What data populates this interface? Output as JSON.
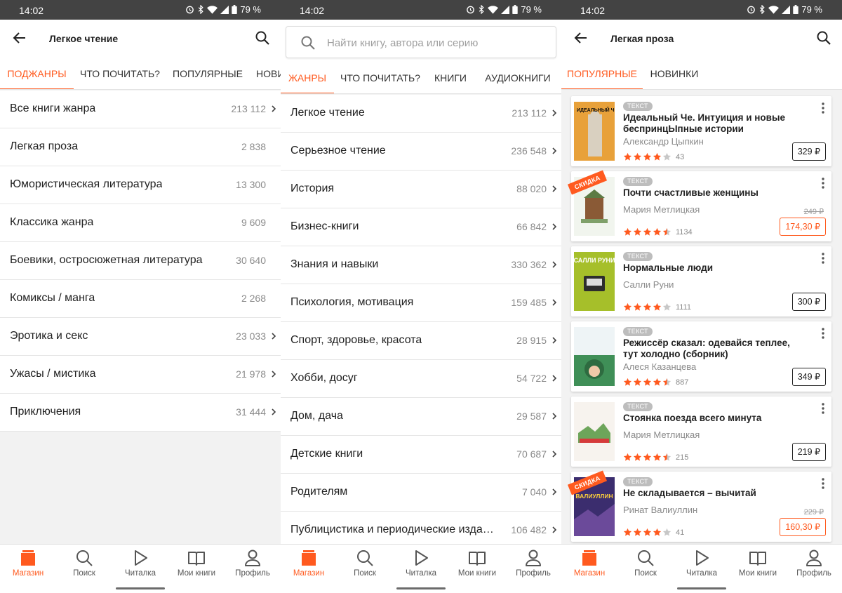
{
  "status": {
    "time": "14:02",
    "battery": "79 %"
  },
  "nav": [
    {
      "label": "Магазин",
      "icon": "shop-icon"
    },
    {
      "label": "Поиск",
      "icon": "search-icon"
    },
    {
      "label": "Читалка",
      "icon": "play-icon"
    },
    {
      "label": "Мои книги",
      "icon": "book-icon"
    },
    {
      "label": "Профиль",
      "icon": "profile-icon"
    }
  ],
  "screen1": {
    "title": "Легкое чтение",
    "tabs": [
      "ПОДЖАНРЫ",
      "ЧТО ПОЧИТАТЬ?",
      "ПОПУЛЯРНЫЕ",
      "НОВИНКИ"
    ],
    "items": [
      {
        "label": "Все книги жанра",
        "count": "213 112"
      },
      {
        "label": "Легкая проза",
        "count": "2 838"
      },
      {
        "label": "Юмористическая литература",
        "count": "13 300"
      },
      {
        "label": "Классика жанра",
        "count": "9 609"
      },
      {
        "label": "Боевики, остросюжетная литература",
        "count": "30 640"
      },
      {
        "label": "Комиксы / манга",
        "count": "2 268"
      },
      {
        "label": "Эротика и секс",
        "count": "23 033"
      },
      {
        "label": "Ужасы / мистика",
        "count": "21 978"
      },
      {
        "label": "Приключения",
        "count": "31 444"
      }
    ]
  },
  "screen2": {
    "search_placeholder": "Найти книгу, автора или серию",
    "tabs": [
      "ЖАНРЫ",
      "ЧТО ПОЧИТАТЬ?",
      "КНИГИ",
      "АУДИОКНИГИ"
    ],
    "items": [
      {
        "label": "Легкое чтение",
        "count": "213 112"
      },
      {
        "label": "Серьезное чтение",
        "count": "236 548"
      },
      {
        "label": "История",
        "count": "88 020"
      },
      {
        "label": "Бизнес-книги",
        "count": "66 842"
      },
      {
        "label": "Знания и навыки",
        "count": "330 362"
      },
      {
        "label": "Психология, мотивация",
        "count": "159 485"
      },
      {
        "label": "Спорт, здоровье, красота",
        "count": "28 915"
      },
      {
        "label": "Хобби, досуг",
        "count": "54 722"
      },
      {
        "label": "Дом, дача",
        "count": "29 587"
      },
      {
        "label": "Детские книги",
        "count": "70 687"
      },
      {
        "label": "Родителям",
        "count": "7 040"
      },
      {
        "label": "Публицистика и периодические изда…",
        "count": "106 482"
      }
    ]
  },
  "screen3": {
    "title": "Легкая проза",
    "tabs": [
      "ПОПУЛЯРНЫЕ",
      "НОВИНКИ"
    ],
    "books": [
      {
        "badge": "ТЕКСТ",
        "title": "Идеальный Че. Интуиция и новые беспринцЫпные истории",
        "author": "Александр Цыпкин",
        "stars": 4,
        "votes": "43",
        "price": "329 ₽",
        "old_price": null,
        "sale": null,
        "cover_text": "ИДЕАЛЬНЫЙ ЧЕ"
      },
      {
        "badge": "ТЕКСТ",
        "title": "Почти счастливые женщины",
        "author": "Мария Метлицкая",
        "stars": 4.5,
        "votes": "1134",
        "price": "174,30 ₽",
        "old_price": "249 ₽",
        "sale": "СКИДКА",
        "cover_text": ""
      },
      {
        "badge": "ТЕКСТ",
        "title": "Нормальные люди",
        "author": "Салли Руни",
        "stars": 4,
        "votes": "1111",
        "price": "300 ₽",
        "old_price": null,
        "sale": null,
        "cover_text": "САЛЛИ РУНИ"
      },
      {
        "badge": "ТЕКСТ",
        "title": "Режиссёр сказал: одевайся теплее, тут холодно (сборник)",
        "author": "Алеся Казанцева",
        "stars": 4.5,
        "votes": "887",
        "price": "349 ₽",
        "old_price": null,
        "sale": null,
        "cover_text": ""
      },
      {
        "badge": "ТЕКСТ",
        "title": "Стоянка поезда всего минута",
        "author": "Мария Метлицкая",
        "stars": 4.5,
        "votes": "215",
        "price": "219 ₽",
        "old_price": null,
        "sale": null,
        "cover_text": ""
      },
      {
        "badge": "ТЕКСТ",
        "title": "Не складывается – вычитай",
        "author": "Ринат Валиуллин",
        "stars": 4,
        "votes": "41",
        "price": "160,30 ₽",
        "old_price": "229 ₽",
        "sale": "СКИДКА",
        "cover_text": "ВАЛИУЛЛИН"
      }
    ]
  },
  "colors": {
    "accent": "#ff5a1f",
    "status_bar": "#434343",
    "muted": "#8a8a8a"
  }
}
